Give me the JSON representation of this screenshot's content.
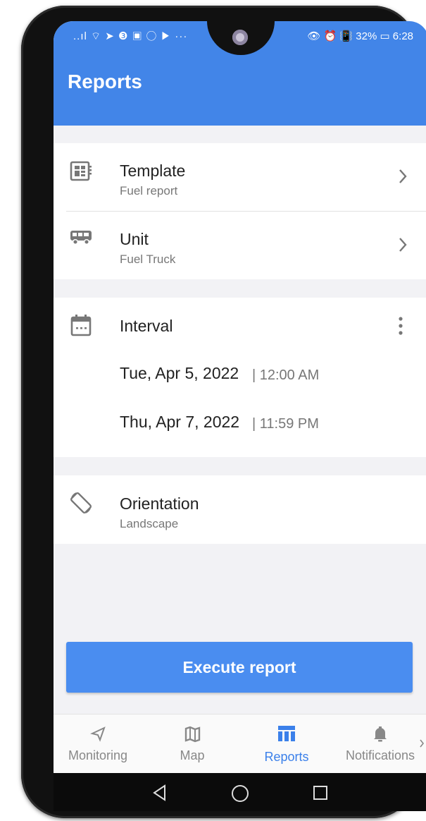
{
  "status_bar": {
    "left_icons": "..ıl ⌔ ➤ ❸ ▣ ◯ ▶ ···",
    "right_text": "👁 ⏰ 📳 32% ▭ 6:28"
  },
  "header": {
    "title": "Reports"
  },
  "template": {
    "label": "Template",
    "value": "Fuel report",
    "icon": "template-icon"
  },
  "unit": {
    "label": "Unit",
    "value": "Fuel Truck",
    "icon": "truck-icon"
  },
  "interval": {
    "label": "Interval",
    "icon": "calendar-icon",
    "from_date": "Tue, Apr 5, 2022",
    "from_time": "| 12:00 AM",
    "to_date": "Thu, Apr 7, 2022",
    "to_time": "| 11:59 PM"
  },
  "orientation": {
    "label": "Orientation",
    "value": "Landscape",
    "icon": "screen-rotation-icon"
  },
  "execute_button": {
    "label": "Execute report"
  },
  "tabs": [
    {
      "label": "Monitoring",
      "icon": "navigation-arrow-icon"
    },
    {
      "label": "Map",
      "icon": "map-icon"
    },
    {
      "label": "Reports",
      "icon": "reports-table-icon",
      "active": true
    },
    {
      "label": "Notifications",
      "icon": "bell-icon"
    }
  ],
  "colors": {
    "primary": "#4285e8",
    "button": "#4a8df0",
    "active_tab": "#3b80ea"
  }
}
